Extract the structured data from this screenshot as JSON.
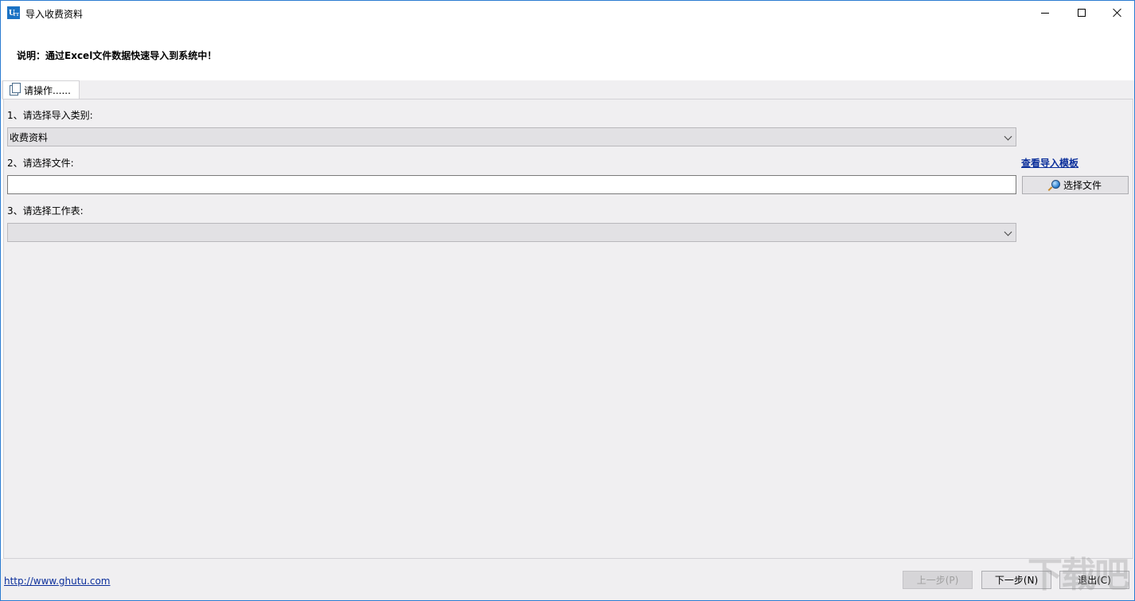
{
  "window": {
    "title": "导入收费资料",
    "app_icon": "U",
    "app_icon_sub": "TT"
  },
  "header": {
    "description": "说明：通过Excel文件数据快速导入到系统中！"
  },
  "tab": {
    "label": "请操作......",
    "icon": "copy-document-icon"
  },
  "form": {
    "step1_label": "1、请选择导入类别:",
    "category_value": "收费资料",
    "step2_label": "2、请选择文件:",
    "template_link": "查看导入模板",
    "file_value": "",
    "choose_file_label": "选择文件",
    "step3_label": "3、请选择工作表:",
    "sheet_value": ""
  },
  "footer": {
    "website": "http://www.ghutu.com",
    "prev_label": "上一步(P)",
    "next_label": "下一步(N)",
    "exit_label": "退出(C)"
  },
  "watermark": "下载吧"
}
